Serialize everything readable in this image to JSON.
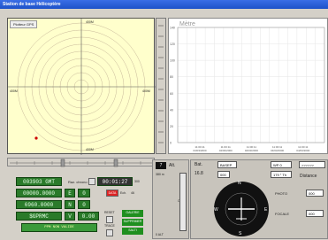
{
  "window": {
    "title": "Station de base Hélicoptère"
  },
  "gps_panel": {
    "title": "Plotteur GPS",
    "top_label": "400M",
    "left_label": "400M",
    "right_label": "400M",
    "bottom_label": "400M"
  },
  "chart": {
    "title": "Mètre"
  },
  "chart_data": {
    "type": "line",
    "title": "Mètre",
    "y_ticks": [
      "140",
      "120",
      "100",
      "80",
      "60",
      "40",
      "20",
      "0"
    ],
    "x_labels": [
      "11:00:11 04/03/2000",
      "11:00:11 04/03/2000",
      "11:00:11 04/03/2000",
      "11:00:11 04/03/2000",
      "11:00:11 04/03/2000"
    ],
    "series": []
  },
  "status": {
    "time": "003903 GMT",
    "raz_chrono": "Raz. chrono",
    "chrono": "00:01:27",
    "chrono_unit": "300",
    "lat": "00000.0000",
    "lat_dir": "E",
    "lat_val": "0",
    "lon": "6960.0000",
    "lon_dir": "N",
    "lon_val": "0",
    "frame": "$GPRMC",
    "frame_v": "V",
    "frame_val": "0.00",
    "data_label": "DATA",
    "ech_label": "Ech.",
    "ech_val": "46",
    "ppm": "PPM NON VALIDE",
    "reset": "RESET",
    "trace": "TRACE",
    "galerie": "GALERIE",
    "supprimer": "SUPPRIMER",
    "salti": "SALTI"
  },
  "alt_panel": {
    "title": "Alt.",
    "val": "7",
    "scale": "0 ALT",
    "off": "OFF",
    "bat_label": "Bat.",
    "bat_val": "380 m",
    "val2": "0 ALT"
  },
  "compass_panel": {
    "basep": "BASEP",
    "m": "M",
    "e": "E",
    "p": "P",
    "r": "R",
    "val1": "000",
    "val2": "16.8",
    "val3": "0.0",
    "n": "N",
    "s": "S",
    "e_dir": "E",
    "w": "W",
    "wp": "WP 0",
    "arrow": ">>>>>>",
    "heading": "179 ° Th",
    "distance": "Distance",
    "photo": "PHOTO",
    "focale": "FOCALE",
    "num1": "000",
    "num2": "000"
  }
}
